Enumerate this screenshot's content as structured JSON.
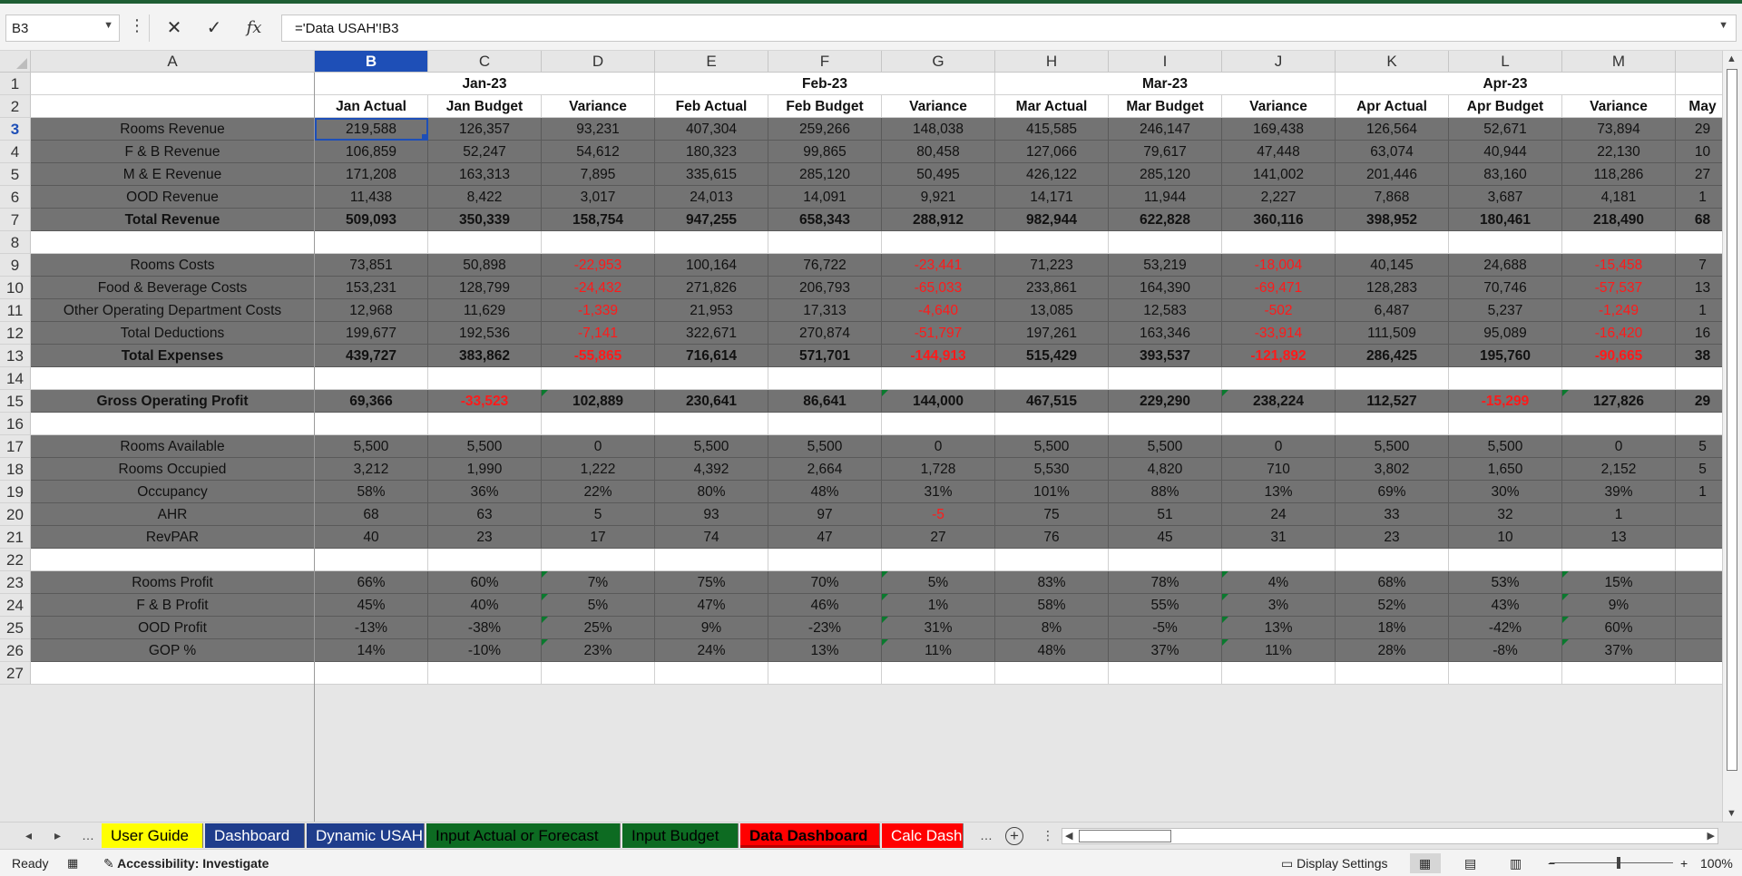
{
  "formula_bar": {
    "name_box": "B3",
    "formula": "='Data USAH'!B3"
  },
  "columns": [
    {
      "letter": "A",
      "w": 313
    },
    {
      "letter": "B",
      "w": 125
    },
    {
      "letter": "C",
      "w": 125
    },
    {
      "letter": "D",
      "w": 125
    },
    {
      "letter": "E",
      "w": 125
    },
    {
      "letter": "F",
      "w": 125
    },
    {
      "letter": "G",
      "w": 125
    },
    {
      "letter": "H",
      "w": 125
    },
    {
      "letter": "I",
      "w": 125
    },
    {
      "letter": "J",
      "w": 125
    },
    {
      "letter": "K",
      "w": 125
    },
    {
      "letter": "L",
      "w": 125
    },
    {
      "letter": "M",
      "w": 125
    },
    {
      "letter": "",
      "w": 60
    }
  ],
  "rows": [
    {
      "n": "1",
      "type": "month",
      "cells": [
        "",
        "",
        "Jan-23",
        "",
        "",
        "Feb-23",
        "",
        "",
        "Mar-23",
        "",
        "",
        "Apr-23",
        "",
        ""
      ]
    },
    {
      "n": "2",
      "type": "hdr",
      "cells": [
        "",
        "Jan Actual",
        "Jan Budget",
        "Variance",
        "Feb Actual",
        "Feb Budget",
        "Variance",
        "Mar Actual",
        "Mar Budget",
        "Variance",
        "Apr Actual",
        "Apr Budget",
        "Variance",
        "May"
      ]
    },
    {
      "n": "3",
      "type": "data",
      "cells": [
        "Rooms Revenue",
        "219,588",
        "126,357",
        "93,231",
        "407,304",
        "259,266",
        "148,038",
        "415,585",
        "246,147",
        "169,438",
        "126,564",
        "52,671",
        "73,894",
        "29"
      ]
    },
    {
      "n": "4",
      "type": "data",
      "cells": [
        "F & B Revenue",
        "106,859",
        "52,247",
        "54,612",
        "180,323",
        "99,865",
        "80,458",
        "127,066",
        "79,617",
        "47,448",
        "63,074",
        "40,944",
        "22,130",
        "10"
      ]
    },
    {
      "n": "5",
      "type": "data",
      "cells": [
        "M & E Revenue",
        "171,208",
        "163,313",
        "7,895",
        "335,615",
        "285,120",
        "50,495",
        "426,122",
        "285,120",
        "141,002",
        "201,446",
        "83,160",
        "118,286",
        "27"
      ]
    },
    {
      "n": "6",
      "type": "data",
      "cells": [
        "OOD Revenue",
        "11,438",
        "8,422",
        "3,017",
        "24,013",
        "14,091",
        "9,921",
        "14,171",
        "11,944",
        "2,227",
        "7,868",
        "3,687",
        "4,181",
        "1"
      ]
    },
    {
      "n": "7",
      "type": "data",
      "bold": true,
      "cells": [
        "Total Revenue",
        "509,093",
        "350,339",
        "158,754",
        "947,255",
        "658,343",
        "288,912",
        "982,944",
        "622,828",
        "360,116",
        "398,952",
        "180,461",
        "218,490",
        "68"
      ]
    },
    {
      "n": "8",
      "type": "blank",
      "cells": [
        "",
        "",
        "",
        "",
        "",
        "",
        "",
        "",
        "",
        "",
        "",
        "",
        "",
        ""
      ]
    },
    {
      "n": "9",
      "type": "data",
      "cells": [
        "Rooms Costs",
        "73,851",
        "50,898",
        "-22,953",
        "100,164",
        "76,722",
        "-23,441",
        "71,223",
        "53,219",
        "-18,004",
        "40,145",
        "24,688",
        "-15,458",
        "7"
      ]
    },
    {
      "n": "10",
      "type": "data",
      "cells": [
        "Food & Beverage Costs",
        "153,231",
        "128,799",
        "-24,432",
        "271,826",
        "206,793",
        "-65,033",
        "233,861",
        "164,390",
        "-69,471",
        "128,283",
        "70,746",
        "-57,537",
        "13"
      ]
    },
    {
      "n": "11",
      "type": "data",
      "cells": [
        "Other Operating Department Costs",
        "12,968",
        "11,629",
        "-1,339",
        "21,953",
        "17,313",
        "-4,640",
        "13,085",
        "12,583",
        "-502",
        "6,487",
        "5,237",
        "-1,249",
        "1"
      ]
    },
    {
      "n": "12",
      "type": "data",
      "cells": [
        "Total Deductions",
        "199,677",
        "192,536",
        "-7,141",
        "322,671",
        "270,874",
        "-51,797",
        "197,261",
        "163,346",
        "-33,914",
        "111,509",
        "95,089",
        "-16,420",
        "16"
      ]
    },
    {
      "n": "13",
      "type": "data",
      "bold": true,
      "cells": [
        "Total Expenses",
        "439,727",
        "383,862",
        "-55,865",
        "716,614",
        "571,701",
        "-144,913",
        "515,429",
        "393,537",
        "-121,892",
        "286,425",
        "195,760",
        "-90,665",
        "38"
      ]
    },
    {
      "n": "14",
      "type": "blank",
      "cells": [
        "",
        "",
        "",
        "",
        "",
        "",
        "",
        "",
        "",
        "",
        "",
        "",
        "",
        ""
      ]
    },
    {
      "n": "15",
      "type": "data",
      "bold": true,
      "tri": [
        3,
        6,
        9,
        12
      ],
      "cells": [
        "Gross Operating Profit",
        "69,366",
        "-33,523",
        "102,889",
        "230,641",
        "86,641",
        "144,000",
        "467,515",
        "229,290",
        "238,224",
        "112,527",
        "-15,299",
        "127,826",
        "29"
      ]
    },
    {
      "n": "16",
      "type": "blank",
      "cells": [
        "",
        "",
        "",
        "",
        "",
        "",
        "",
        "",
        "",
        "",
        "",
        "",
        "",
        ""
      ]
    },
    {
      "n": "17",
      "type": "data",
      "cells": [
        "Rooms Available",
        "5,500",
        "5,500",
        "0",
        "5,500",
        "5,500",
        "0",
        "5,500",
        "5,500",
        "0",
        "5,500",
        "5,500",
        "0",
        "5"
      ]
    },
    {
      "n": "18",
      "type": "data",
      "cells": [
        "Rooms Occupied",
        "3,212",
        "1,990",
        "1,222",
        "4,392",
        "2,664",
        "1,728",
        "5,530",
        "4,820",
        "710",
        "3,802",
        "1,650",
        "2,152",
        "5"
      ]
    },
    {
      "n": "19",
      "type": "data",
      "cells": [
        "Occupancy",
        "58%",
        "36%",
        "22%",
        "80%",
        "48%",
        "31%",
        "101%",
        "88%",
        "13%",
        "69%",
        "30%",
        "39%",
        "1"
      ]
    },
    {
      "n": "20",
      "type": "data",
      "cells": [
        "AHR",
        "68",
        "63",
        "5",
        "93",
        "97",
        "-5",
        "75",
        "51",
        "24",
        "33",
        "32",
        "1",
        ""
      ]
    },
    {
      "n": "21",
      "type": "data",
      "cells": [
        "RevPAR",
        "40",
        "23",
        "17",
        "74",
        "47",
        "27",
        "76",
        "45",
        "31",
        "23",
        "10",
        "13",
        ""
      ]
    },
    {
      "n": "22",
      "type": "blank",
      "cells": [
        "",
        "",
        "",
        "",
        "",
        "",
        "",
        "",
        "",
        "",
        "",
        "",
        "",
        ""
      ]
    },
    {
      "n": "23",
      "type": "data",
      "tri": [
        3,
        6,
        9,
        12
      ],
      "cells": [
        "Rooms Profit",
        "66%",
        "60%",
        "7%",
        "75%",
        "70%",
        "5%",
        "83%",
        "78%",
        "4%",
        "68%",
        "53%",
        "15%",
        ""
      ]
    },
    {
      "n": "24",
      "type": "data",
      "tri": [
        3,
        6,
        9,
        12
      ],
      "cells": [
        "F & B Profit",
        "45%",
        "40%",
        "5%",
        "47%",
        "46%",
        "1%",
        "58%",
        "55%",
        "3%",
        "52%",
        "43%",
        "9%",
        ""
      ]
    },
    {
      "n": "25",
      "type": "data",
      "tri": [
        3,
        6,
        9,
        12
      ],
      "cells": [
        "OOD Profit",
        "-13%",
        "-38%",
        "25%",
        "9%",
        "-23%",
        "31%",
        "8%",
        "-5%",
        "13%",
        "18%",
        "-42%",
        "60%",
        ""
      ]
    },
    {
      "n": "26",
      "type": "data",
      "tri": [
        3,
        6,
        9,
        12
      ],
      "cells": [
        "GOP %",
        "14%",
        "-10%",
        "23%",
        "24%",
        "13%",
        "11%",
        "48%",
        "37%",
        "11%",
        "28%",
        "-8%",
        "37%",
        ""
      ]
    },
    {
      "n": "27",
      "type": "blank",
      "cells": [
        "",
        "",
        "",
        "",
        "",
        "",
        "",
        "",
        "",
        "",
        "",
        "",
        "",
        ""
      ]
    }
  ],
  "sheet_tabs": [
    {
      "label": "User Guide",
      "bg": "#ffff00",
      "fg": "#000000",
      "w": 112
    },
    {
      "label": "Dashboard",
      "bg": "#1f3d8c",
      "fg": "#ffffff",
      "w": 110
    },
    {
      "label": "Dynamic USAH",
      "bg": "#1f3d8c",
      "fg": "#ffffff",
      "w": 130
    },
    {
      "label": "Input Actual or Forecast",
      "bg": "#0d6b22",
      "fg": "#000000",
      "w": 214
    },
    {
      "label": "Input Budget",
      "bg": "#0d6b22",
      "fg": "#000000",
      "w": 128
    },
    {
      "label": "Data Dashboard",
      "bg": "#ff0000",
      "fg": "#000000",
      "w": 154,
      "active": true
    },
    {
      "label": "Calc Dash",
      "bg": "#ff0000",
      "fg": "#ffffff",
      "w": 90
    }
  ],
  "tab_nav": {
    "prev": "◂",
    "next": "▸",
    "more": "…"
  },
  "status": {
    "ready": "Ready",
    "accessibility": "Accessibility: Investigate",
    "display_settings": "Display Settings",
    "zoom": "100%",
    "zoom_minus": "−",
    "zoom_plus": "+"
  },
  "colors": {
    "selection": "#1e4fb7",
    "negative": "#ff1a1a",
    "data_fill": "#737373",
    "error_triangle": "#0a7a2e"
  }
}
